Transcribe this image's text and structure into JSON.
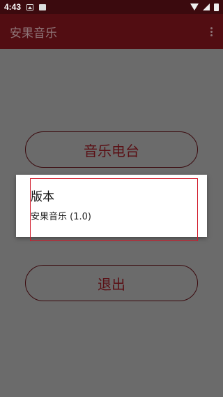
{
  "status_bar": {
    "time": "4:43",
    "icons": [
      "image-notification-icon",
      "font-notification-icon",
      "wifi-icon",
      "signal-icon",
      "battery-icon"
    ]
  },
  "app_bar": {
    "title": "安果音乐",
    "menu_icon": "overflow-menu-icon"
  },
  "main": {
    "radio_button_label": "音乐电台",
    "exit_button_label": "退出"
  },
  "dialog": {
    "title": "版本",
    "message": "安果音乐 (1.0)"
  },
  "colors": {
    "status_bar": "#3b0a0e",
    "app_bar": "#520d12",
    "scrim_background": "#6b6b6b",
    "accent": "#5a0f14",
    "highlight": "#d11a2a"
  }
}
